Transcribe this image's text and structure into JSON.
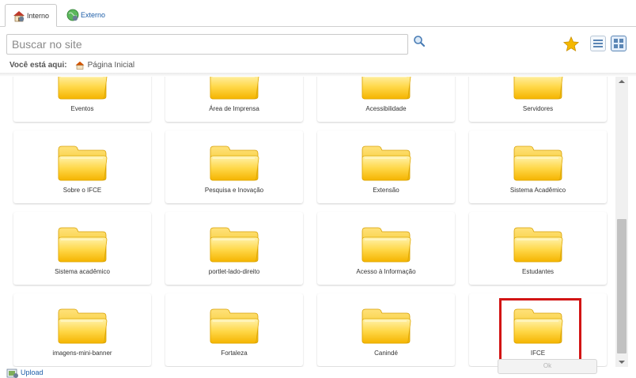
{
  "tabs": [
    {
      "label": "Interno",
      "active": true
    },
    {
      "label": "Externo",
      "active": false
    }
  ],
  "search": {
    "placeholder": "Buscar no site",
    "value": ""
  },
  "breadcrumb": {
    "label": "Você está aqui:",
    "home": "Página Inicial"
  },
  "folders": [
    "Eventos",
    "Área de Imprensa",
    "Acessibilidade",
    "Servidores",
    "Sobre o IFCE",
    "Pesquisa e Inovação",
    "Extensão",
    "Sistema Acadêmico",
    "Sistema acadêmico",
    "portlet-lado-direito",
    "Acesso à Informação",
    "Estudantes",
    "imagens-mini-banner",
    "Fortaleza",
    "Canindé",
    "IFCE"
  ],
  "selected_folder": "IFCE",
  "footer": {
    "upload_label": "Upload",
    "ok_label": "Ok"
  },
  "colors": {
    "folder": "#ffd23a",
    "link": "#1d5ea8",
    "highlight": "#d21414"
  }
}
